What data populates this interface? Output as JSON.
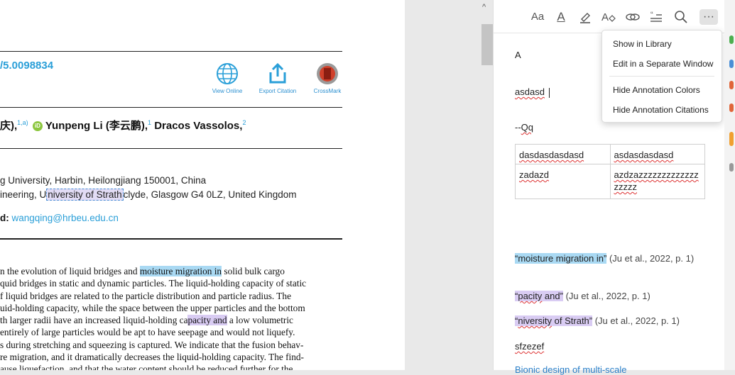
{
  "pdf": {
    "doi": "/5.0098834",
    "tools": [
      {
        "label": "View Online",
        "icon": "globe-icon"
      },
      {
        "label": "Export Citation",
        "icon": "export-icon"
      },
      {
        "label": "CrossMark",
        "icon": "crossmark-icon"
      }
    ],
    "authors": {
      "part1": "庆),",
      "sup1": "1,a)",
      "name2": "Yunpeng Li (李云鹏),",
      "sup2": "1",
      "name3": "Dracos Vassolos,",
      "sup3": "2"
    },
    "affil1": "g University, Harbin, Heilongjiang 150001, China",
    "affil2_pre": "ineering, U",
    "affil2_sel": "niversity of Strath",
    "affil2_post": "clyde, Glasgow G4 0LZ, United Kingdom",
    "email_label": "d:",
    "email": "wangqing@hrbeu.edu.cn",
    "abstract": {
      "l1a": "n the evolution of liquid bridges and ",
      "l1b": "moisture migration in",
      "l1c": " solid bulk cargo",
      "l2": "quid bridges in static and dynamic particles. The liquid-holding capacity of static",
      "l3": "f liquid bridges are related to the particle distribution and particle radius. The",
      "l4": "uid-holding capacity, while the space between the upper particles and the bottom",
      "l5a": "th larger radii have an increased liquid-holding ca",
      "l5b": "pacity and",
      "l5c": " a low volumetric",
      "l6": "entirely of large particles would be apt to have seepage and would not liquefy.",
      "l7": "s during stretching and squeezing is captured. We indicate that the fusion behav-",
      "l8": "re migration, and it dramatically decreases the liquid-holding capacity. The find-",
      "l9": "ause liquefaction, and that the water content should be reduced further for the"
    }
  },
  "notes": {
    "toolbar_icons": [
      "font-size-icon",
      "text-color-icon",
      "highlight-icon",
      "clear-format-icon",
      "link-icon",
      "citation-icon",
      "search-icon",
      "more-icon"
    ],
    "toolbar_glyphs": {
      "font": "Aa",
      "color": "A",
      "search": "⚲",
      "more": "···"
    },
    "line_a": "A",
    "line_b": "asdasd",
    "line_c_dash": "--",
    "line_c": "Qq",
    "table": [
      [
        "dasdasdasdasd",
        "asdasdasdasd"
      ],
      [
        "zadazd",
        "azdzazzzzzzzzzzzzzzzzzz"
      ]
    ],
    "quote1": "“moisture migration in”",
    "cite1": " (Ju et al., 2022, p. 1)",
    "quote2_pre": "“",
    "quote2_word": "pacity",
    "quote2_post": " and”",
    "cite2": " (Ju et al., 2022, p. 1)",
    "quote3_pre": "“",
    "quote3_word": "niversity",
    "quote3_post": " of Strath”",
    "cite3": " (Ju et al., 2022, p. 1)",
    "last": "sfzezef",
    "cut_link": "Bionic design of multi-scale"
  },
  "menu": {
    "items": [
      "Show in Library",
      "Edit in a Separate Window",
      "Hide Annotation Colors",
      "Hide Annotation Citations"
    ]
  },
  "colors": {
    "accent": "#2a9fd8",
    "highlight_blue": "#a9d9f3",
    "highlight_purple": "#d9ccf3"
  }
}
